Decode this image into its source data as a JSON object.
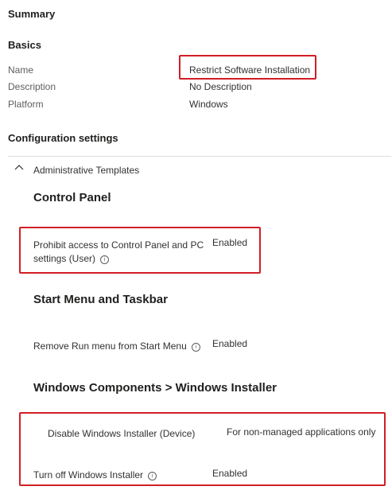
{
  "summary_title": "Summary",
  "basics": {
    "heading": "Basics",
    "fields": [
      {
        "label": "Name",
        "value": "Restrict Software Installation"
      },
      {
        "label": "Description",
        "value": "No Description"
      },
      {
        "label": "Platform",
        "value": "Windows"
      }
    ]
  },
  "config": {
    "heading": "Configuration settings",
    "category": "Administrative Templates",
    "groups": [
      {
        "title": "Control Panel",
        "settings": [
          {
            "name_line1": "Prohibit access to Control Panel and PC",
            "name_line2": "settings (User)",
            "value": "Enabled"
          }
        ]
      },
      {
        "title": "Start Menu and Taskbar",
        "settings": [
          {
            "name": "Remove Run menu from Start Menu",
            "value": "Enabled"
          }
        ]
      },
      {
        "title": "Windows Components > Windows Installer",
        "settings": [
          {
            "name": "Disable Windows Installer (Device)",
            "value": "For non-managed applications only"
          },
          {
            "name": "Turn off Windows Installer",
            "value": "Enabled"
          }
        ]
      }
    ]
  },
  "icons": {
    "info": "info-icon",
    "chevron": "chevron-up-icon"
  },
  "colors": {
    "highlight": "#d11f25",
    "divider": "#e1dfdd"
  }
}
